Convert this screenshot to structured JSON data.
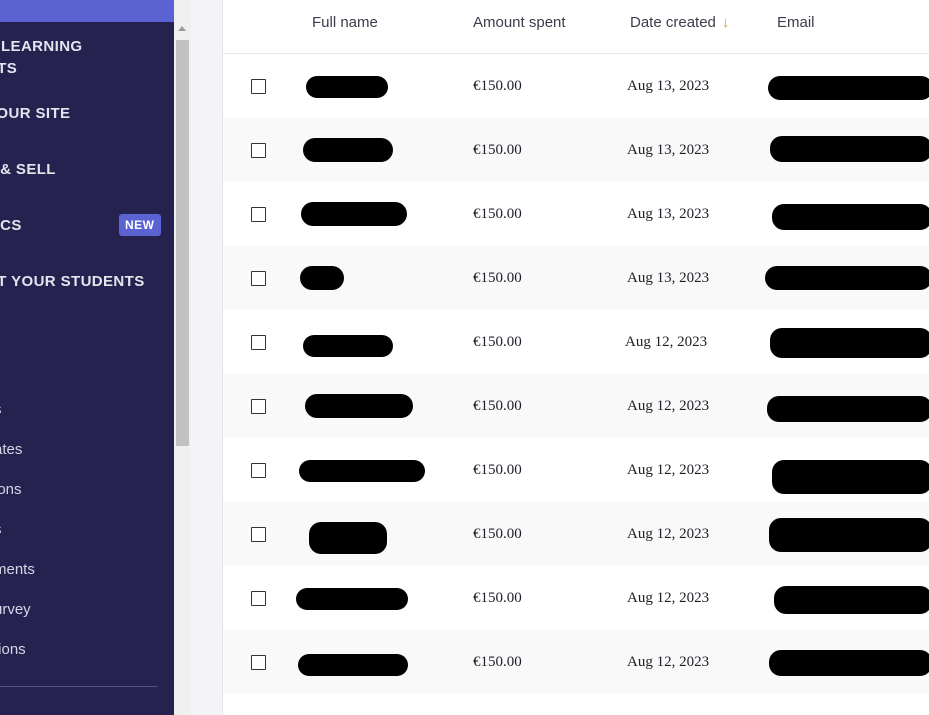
{
  "sidebar": {
    "sections": [
      {
        "line1": "E LEARNING",
        "line2": "CTS"
      },
      {
        "label": "YOUR SITE"
      },
      {
        "label": "T & SELL"
      },
      {
        "label": "TICS",
        "badge": "NEW"
      },
      {
        "label": "RT YOUR STUDENTS"
      }
    ],
    "sub_items": [
      "s",
      "ates",
      "ions",
      "s",
      "ments",
      "urvey",
      "tions"
    ]
  },
  "table": {
    "columns": {
      "full_name": "Full name",
      "amount_spent": "Amount spent",
      "date_created": "Date created",
      "email": "Email"
    },
    "sort_icon": "arrow-down-icon",
    "rows": [
      {
        "amount": "€150.00",
        "date": "Aug 13, 2023"
      },
      {
        "amount": "€150.00",
        "date": "Aug 13, 2023"
      },
      {
        "amount": "€150.00",
        "date": "Aug 13, 2023"
      },
      {
        "amount": "€150.00",
        "date": "Aug 13, 2023"
      },
      {
        "amount": "€150.00",
        "date": "Aug 12, 2023"
      },
      {
        "amount": "€150.00",
        "date": "Aug 12, 2023"
      },
      {
        "amount": "€150.00",
        "date": "Aug 12, 2023"
      },
      {
        "amount": "€150.00",
        "date": "Aug 12, 2023"
      },
      {
        "amount": "€150.00",
        "date": "Aug 12, 2023"
      },
      {
        "amount": "€150.00",
        "date": "Aug 12, 2023"
      }
    ]
  },
  "colors": {
    "sidebar_bg": "#262250",
    "accent": "#5b63d3",
    "sort_arrow": "#d89b20"
  }
}
